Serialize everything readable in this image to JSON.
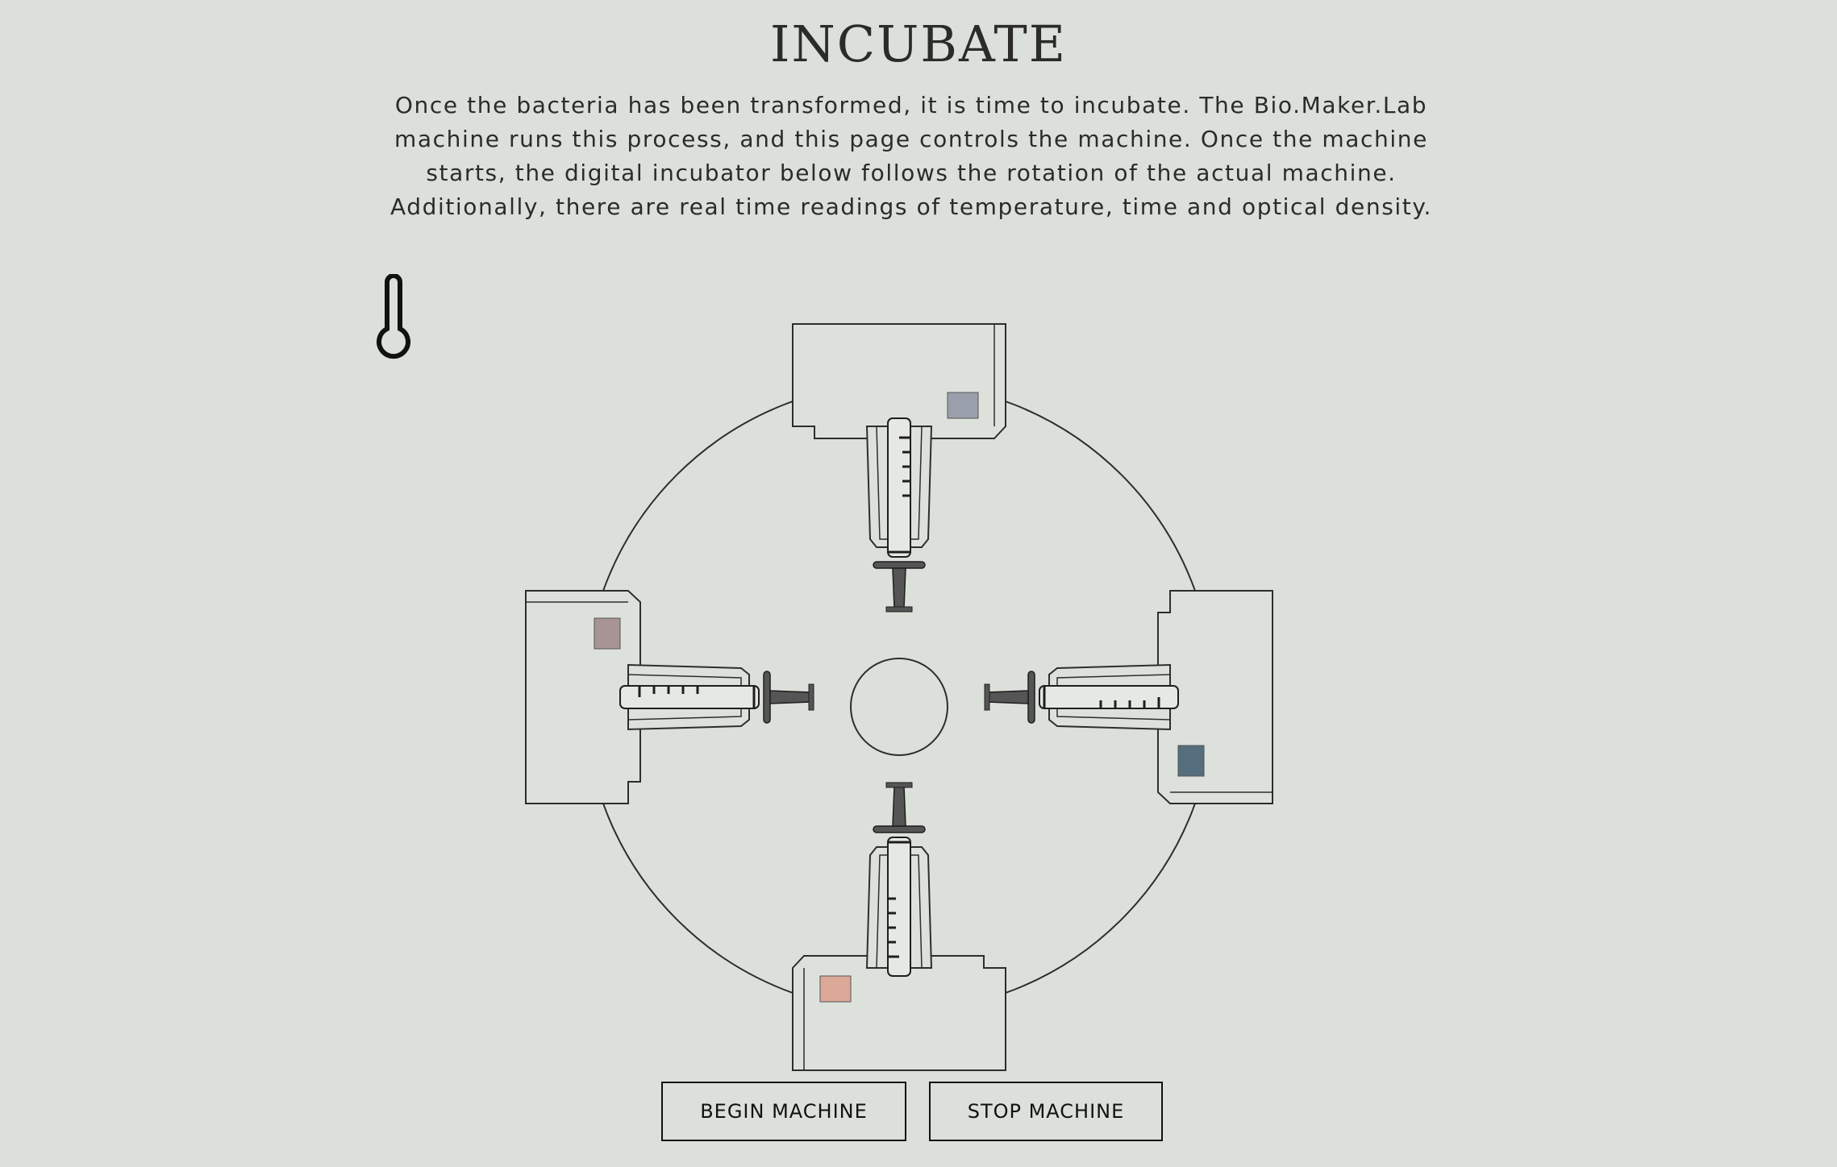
{
  "page": {
    "title": "INCUBATE",
    "intro": "Once the bacteria has been transformed, it is time to incubate. The Bio.Maker.Lab machine runs this process, and this page controls the machine. Once the machine starts, the digital incubator below follows the rotation of the actual machine. Additionally, there are real time readings of temperature, time and optical density."
  },
  "icons": {
    "temperature": "thermometer-icon"
  },
  "incubator": {
    "stations": [
      {
        "position": "top",
        "sample_color": "#9aa0ab"
      },
      {
        "position": "right",
        "sample_color": "#556e7d"
      },
      {
        "position": "bottom",
        "sample_color": "#dca898"
      },
      {
        "position": "left",
        "sample_color": "#a89494"
      }
    ],
    "colors": {
      "background": "#dce0da",
      "line": "#2d2d2d",
      "plunger": "#555555"
    }
  },
  "controls": {
    "begin_label": "BEGIN MACHINE",
    "stop_label": "STOP MACHINE"
  }
}
